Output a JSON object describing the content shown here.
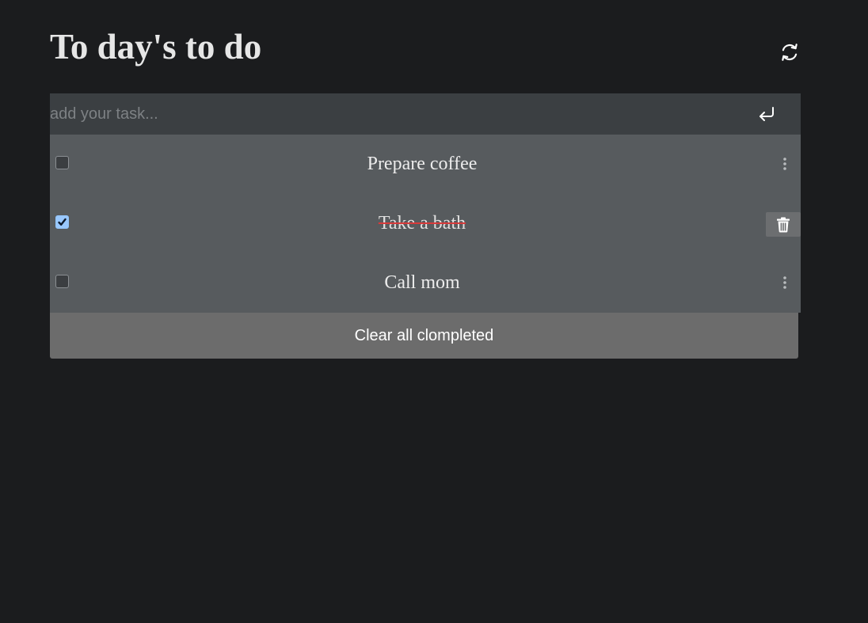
{
  "header": {
    "title": "To day's to do",
    "refresh_icon": "refresh-icon"
  },
  "input": {
    "placeholder": "add your task...",
    "value": "",
    "enter_icon": "enter-icon"
  },
  "tasks": [
    {
      "text": "Prepare coffee",
      "completed": false,
      "action_icon": "more-vertical-icon"
    },
    {
      "text": "Take a bath",
      "completed": true,
      "action_icon": "trash-icon"
    },
    {
      "text": "Call mom",
      "completed": false,
      "action_icon": "more-vertical-icon"
    }
  ],
  "footer": {
    "clear_label": "Clear all clompleted"
  },
  "colors": {
    "background": "#1b1c1e",
    "input_bg": "#3b3f42",
    "list_bg": "#575b5e",
    "clear_button_bg": "#6c6c6c",
    "strike_color": "#d73a3a",
    "checkbox_checked": "#99c8ff"
  }
}
